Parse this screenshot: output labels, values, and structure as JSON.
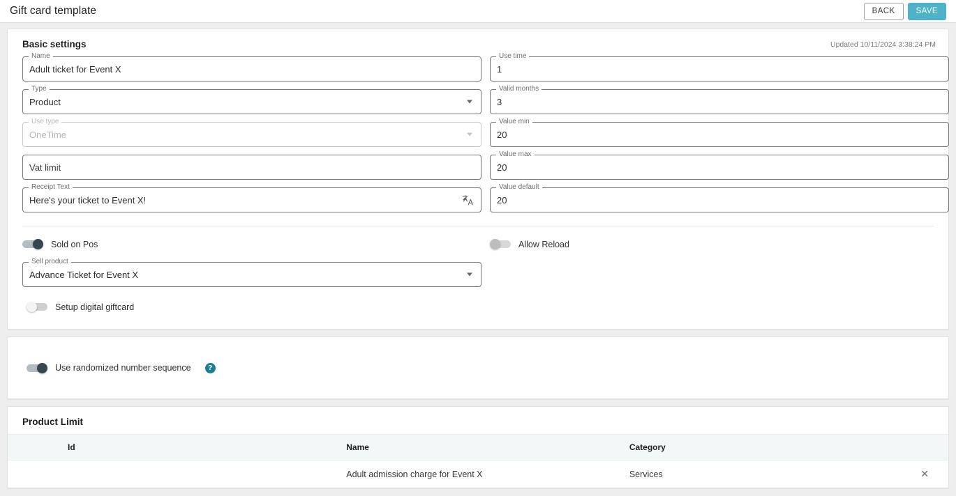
{
  "header": {
    "title": "Gift card template",
    "back_label": "BACK",
    "save_label": "SAVE",
    "save_color": "#4eb3c9"
  },
  "basic_settings": {
    "title": "Basic settings",
    "updated": "Updated 10/11/2024 3:38:24 PM",
    "left_fields": [
      {
        "label": "Name",
        "value": "Adult ticket for Event X",
        "type": "text"
      },
      {
        "label": "Type",
        "value": "Product",
        "type": "select"
      },
      {
        "label": "Use type",
        "value": "OneTime",
        "type": "select-disabled"
      },
      {
        "label": "",
        "value": "Vat limit",
        "type": "placeholder"
      },
      {
        "label": "Receipt Text",
        "value": "Here's your ticket to Event X!",
        "type": "text-translate",
        "icon": "translate-icon"
      }
    ],
    "right_fields": [
      {
        "label": "Use time",
        "value": "1",
        "type": "text"
      },
      {
        "label": "Valid months",
        "value": "3",
        "type": "text"
      },
      {
        "label": "Value min",
        "value": "20",
        "type": "text"
      },
      {
        "label": "Value max",
        "value": "20",
        "type": "text"
      },
      {
        "label": "Value default",
        "value": "20",
        "type": "text"
      }
    ],
    "toggles": {
      "sold_on_pos": {
        "label": "Sold on Pos",
        "state": "on"
      },
      "allow_reload": {
        "label": "Allow Reload",
        "state": "off"
      },
      "setup_digital_giftcard": {
        "label": "Setup digital giftcard",
        "state": "off"
      }
    },
    "sell_product": {
      "label": "Sell product",
      "value": "Advance Ticket for Event X"
    }
  },
  "randomized": {
    "label": "Use randomized number sequence",
    "state": "on",
    "help_glyph": "?",
    "help_color": "#1a7f92"
  },
  "product_limit": {
    "title": "Product Limit",
    "columns": [
      "Id",
      "Name",
      "Category"
    ],
    "rows": [
      {
        "id": "",
        "name": "Adult admission charge for Event X",
        "category": "Services",
        "remove_glyph": "✕"
      }
    ]
  }
}
